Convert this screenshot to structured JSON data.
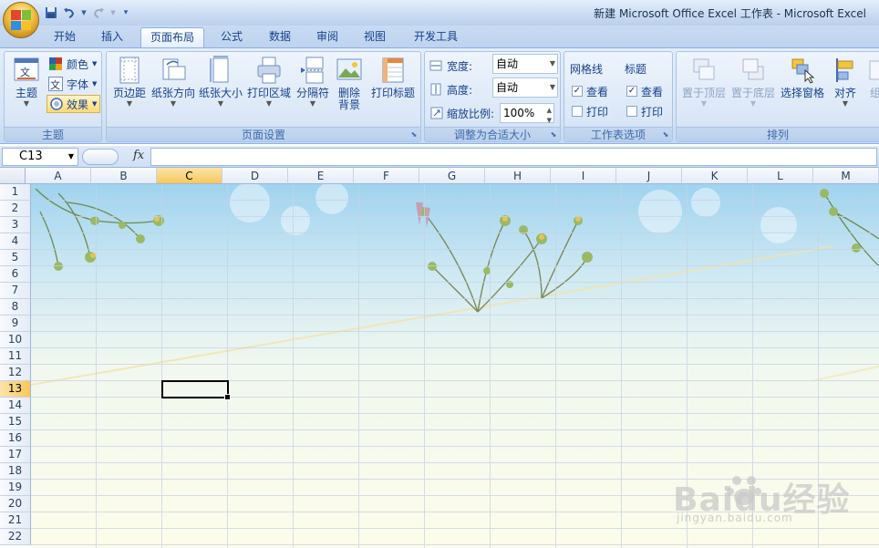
{
  "window": {
    "title": "新建 Microsoft Office Excel 工作表 - Microsoft Excel"
  },
  "quick_access": [
    {
      "icon": "save-icon"
    },
    {
      "icon": "undo-icon"
    },
    {
      "icon": "redo-icon"
    },
    {
      "icon": "customize-qat-icon"
    }
  ],
  "tabs": [
    "开始",
    "插入",
    "页面布局",
    "公式",
    "数据",
    "审阅",
    "视图",
    "开发工具"
  ],
  "active_tab": "页面布局",
  "ribbon": {
    "themes_group": {
      "label": "主题",
      "themes_button": "主题",
      "colors": "颜色",
      "fonts": "字体",
      "effects": "效果"
    },
    "page_setup_group": {
      "label": "页面设置",
      "margins": "页边距",
      "orientation": "纸张方向",
      "size": "纸张大小",
      "print_area": "打印区域",
      "breaks": "分隔符",
      "delete_background_1": "删除",
      "delete_background_2": "背景",
      "print_titles": "打印标题"
    },
    "scale_group": {
      "label": "调整为合适大小",
      "width_label": "宽度:",
      "width_value": "自动",
      "height_label": "高度:",
      "height_value": "自动",
      "scale_label": "缩放比例:",
      "scale_value": "100%"
    },
    "sheet_options_group": {
      "label": "工作表选项",
      "gridlines_title": "网格线",
      "headings_title": "标题",
      "view": "查看",
      "print": "打印",
      "gridlines_view_checked": true,
      "gridlines_print_checked": false,
      "headings_view_checked": true,
      "headings_print_checked": false
    },
    "arrange_group": {
      "label": "排列",
      "bring_front": "置于顶层",
      "send_back": "置于底层",
      "selection_pane": "选择窗格",
      "align": "对齐",
      "group_partial": "组"
    }
  },
  "formula_bar": {
    "name_box": "C13",
    "fx": "fx",
    "formula": ""
  },
  "sheet": {
    "columns": [
      "A",
      "B",
      "C",
      "D",
      "E",
      "F",
      "G",
      "H",
      "I",
      "J",
      "K",
      "L",
      "M"
    ],
    "rows": [
      "1",
      "2",
      "3",
      "4",
      "5",
      "6",
      "7",
      "8",
      "9",
      "10",
      "11",
      "12",
      "13",
      "14",
      "15",
      "16",
      "17",
      "18",
      "19",
      "20",
      "21",
      "22"
    ],
    "selected_column": "C",
    "selected_row": "13",
    "background": "sky-and-wildflowers"
  },
  "watermark": {
    "logo": "Baidu经验",
    "url": "jingyan.baidu.com"
  },
  "colors": {
    "ribbon_text": "#15428b",
    "selection_header": "#f8c85a",
    "grid_line": "#c5d3e6"
  }
}
